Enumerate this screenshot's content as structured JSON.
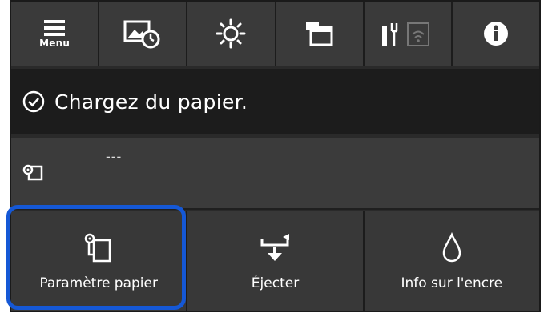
{
  "toolbar": {
    "menu_label": "Menu",
    "icons": [
      "menu-icon",
      "maintenance-clock-icon",
      "brightness-icon",
      "paper-source-icon",
      "connectivity-icon",
      "info-icon"
    ]
  },
  "status": {
    "message": "Chargez du papier.",
    "icon": "check-circle-icon"
  },
  "paper_info": {
    "value": "---",
    "icon": "paper-roll-icon"
  },
  "actions": [
    {
      "label": "Paramètre papier",
      "icon": "paper-setting-icon",
      "highlighted": true
    },
    {
      "label": "Éjecter",
      "icon": "eject-icon",
      "highlighted": false
    },
    {
      "label": "Info sur l'encre",
      "icon": "ink-drop-icon",
      "highlighted": false
    }
  ],
  "colors": {
    "highlight": "#1558d6",
    "panel_dark": "#1c1c1c",
    "panel": "#3a3a3a",
    "text": "#ffffff"
  }
}
